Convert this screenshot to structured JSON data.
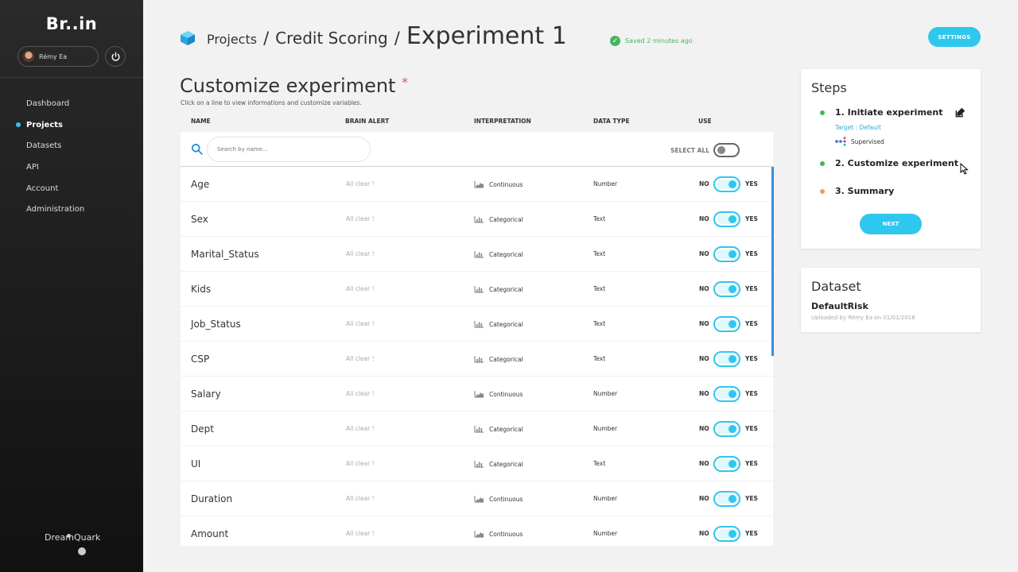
{
  "sidebar": {
    "logo": "Br..in",
    "user_name": "Rémy Ea",
    "items": [
      {
        "label": "Dashboard",
        "active": false
      },
      {
        "label": "Projects",
        "active": true
      },
      {
        "label": "Datasets",
        "active": false
      },
      {
        "label": "API",
        "active": false
      },
      {
        "label": "Account",
        "active": false
      },
      {
        "label": "Administration",
        "active": false
      }
    ],
    "footer_logo_left": "Dream",
    "footer_logo_right": "Quark"
  },
  "header": {
    "crumbs": [
      "Projects",
      "Credit Scoring",
      "Experiment 1"
    ],
    "separator": "/",
    "saved_text": "Saved 2 minutes ago",
    "settings_label": "SETTINGS"
  },
  "main": {
    "title": "Customize experiment",
    "required_mark": "*",
    "subtitle": "Click on a line to view informations and customize variables.",
    "columns": {
      "name": "NAME",
      "brain_alert": "BRAIN ALERT",
      "interpretation": "INTERPRETATION",
      "data_type": "DATA TYPE",
      "use": "USE"
    },
    "search_placeholder": "Search by name...",
    "select_all_label": "SELECT ALL",
    "no_label": "NO",
    "yes_label": "YES",
    "rows": [
      {
        "name": "Age",
        "alert": "All clear !",
        "interp": "Continuous",
        "type": "Number",
        "use": true
      },
      {
        "name": "Sex",
        "alert": "All clear !",
        "interp": "Categorical",
        "type": "Text",
        "use": true
      },
      {
        "name": "Marital_Status",
        "alert": "All clear !",
        "interp": "Categorical",
        "type": "Text",
        "use": true
      },
      {
        "name": "Kids",
        "alert": "All clear !",
        "interp": "Categorical",
        "type": "Text",
        "use": true
      },
      {
        "name": "Job_Status",
        "alert": "All clear !",
        "interp": "Categorical",
        "type": "Text",
        "use": true
      },
      {
        "name": "CSP",
        "alert": "All clear !",
        "interp": "Categorical",
        "type": "Text",
        "use": true
      },
      {
        "name": "Salary",
        "alert": "All clear !",
        "interp": "Continuous",
        "type": "Number",
        "use": true
      },
      {
        "name": "Dept",
        "alert": "All clear !",
        "interp": "Categorical",
        "type": "Number",
        "use": true
      },
      {
        "name": "UI",
        "alert": "All clear !",
        "interp": "Categorical",
        "type": "Text",
        "use": true
      },
      {
        "name": "Duration",
        "alert": "All clear !",
        "interp": "Continuous",
        "type": "Number",
        "use": true
      },
      {
        "name": "Amount",
        "alert": "All clear !",
        "interp": "Continuous",
        "type": "Number",
        "use": true
      }
    ]
  },
  "steps": {
    "title": "Steps",
    "items": [
      {
        "label": "1. Initiate experiment",
        "color": "#45b65b"
      },
      {
        "label": "2. Customize experiment",
        "color": "#45b65b"
      },
      {
        "label": "3. Summary",
        "color": "#f0a04a"
      }
    ],
    "target_text": "Target : Default",
    "learning_type": "Supervised",
    "next_label": "NEXT"
  },
  "dataset": {
    "title": "Dataset",
    "name": "DefaultRisk",
    "meta": "Uploaded by Rémy Ea on 01/01/2018"
  },
  "colors": {
    "accent": "#2ec7ee",
    "success": "#45b65b",
    "warning": "#f0a04a",
    "link": "#2ea8d8"
  }
}
